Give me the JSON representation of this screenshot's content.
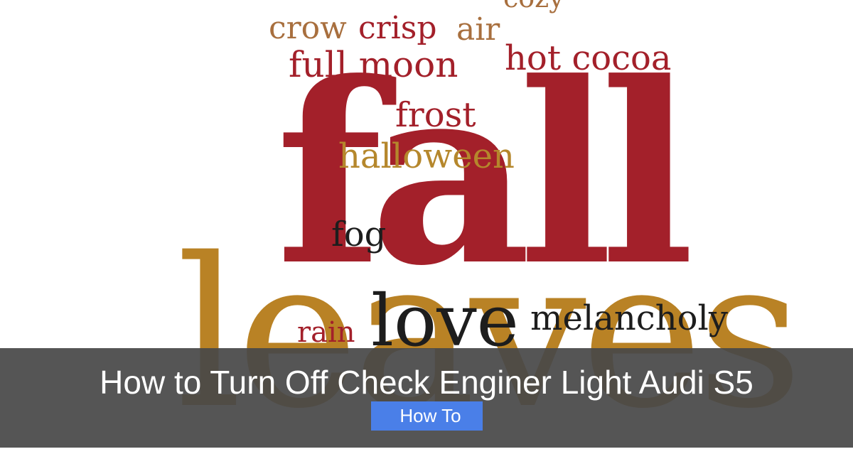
{
  "word_cloud": {
    "words": {
      "cozy": "cozy",
      "crow": "crow",
      "crisp": "crisp",
      "air": "air",
      "full_moon": "full moon",
      "hot_cocoa": "hot cocoa",
      "frost": "frost",
      "halloween": "halloween",
      "fog": "fog",
      "fall": "fall",
      "love": "love",
      "rain": "rain",
      "melancholy": "melancholy",
      "leaves": "leaves"
    },
    "colors": {
      "red": "#a3202a",
      "brown": "#a86f3e",
      "gold": "#b5872c",
      "dark": "#1d1d1d"
    }
  },
  "banner": {
    "title": "How to Turn Off Check Enginer Light Audi S5",
    "category_icon": "tag-icon",
    "category_icon_glyph": "",
    "category_label": "How To",
    "category_bg": "#4a7fe8"
  }
}
